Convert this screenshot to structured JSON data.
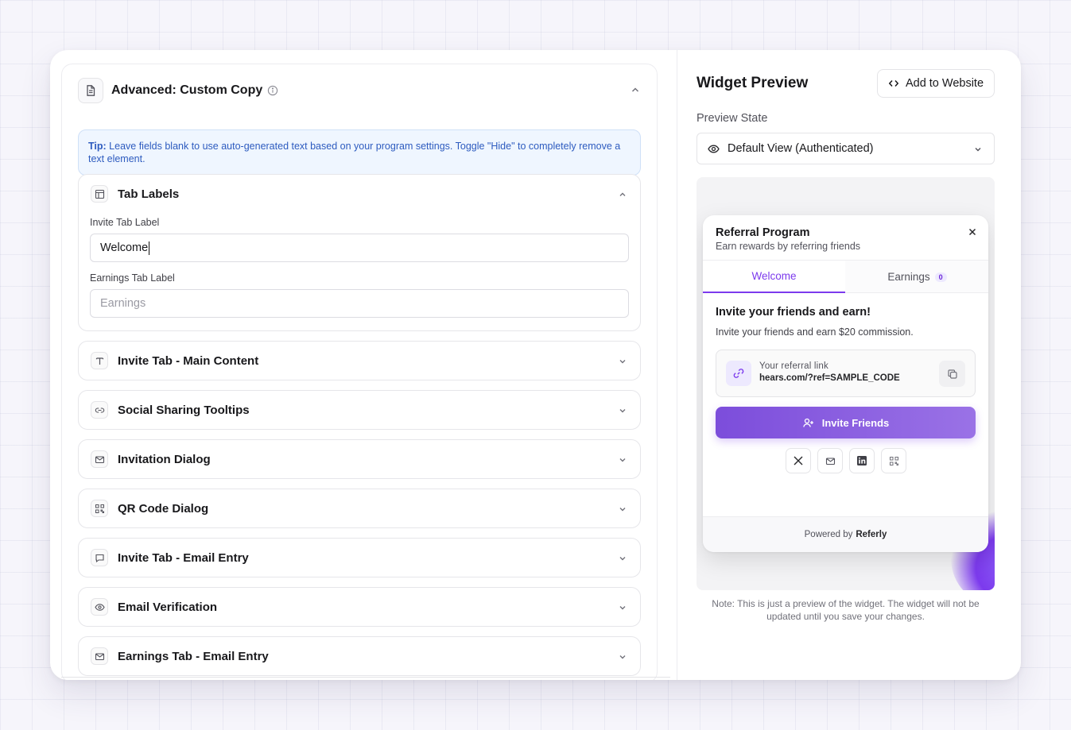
{
  "panel": {
    "title": "Advanced: Custom Copy",
    "tip_prefix": "Tip:",
    "tip_text": " Leave fields blank to use auto-generated text based on your program settings. Toggle \"Hide\" to completely remove a text element."
  },
  "tab_labels": {
    "title": "Tab Labels",
    "invite_label": "Invite Tab Label",
    "invite_value": "Welcome",
    "earnings_label": "Earnings Tab Label",
    "earnings_placeholder": "Earnings"
  },
  "sections": [
    {
      "title": "Invite Tab - Main Content",
      "icon": "text-icon"
    },
    {
      "title": "Social Sharing Tooltips",
      "icon": "link-icon"
    },
    {
      "title": "Invitation Dialog",
      "icon": "mail-icon"
    },
    {
      "title": "QR Code Dialog",
      "icon": "qr-code-icon"
    },
    {
      "title": "Invite Tab - Email Entry",
      "icon": "message-icon"
    },
    {
      "title": "Email Verification",
      "icon": "eye-icon"
    },
    {
      "title": "Earnings Tab - Email Entry",
      "icon": "mail-icon"
    }
  ],
  "preview": {
    "title": "Widget Preview",
    "add_button": "Add to Website",
    "state_label": "Preview State",
    "state_value": "Default View (Authenticated)",
    "note": "Note: This is just a preview of the widget. The widget will not be updated until you save your changes."
  },
  "widget": {
    "title": "Referral Program",
    "subtitle": "Earn rewards by referring friends",
    "tab_welcome": "Welcome",
    "tab_earnings": "Earnings",
    "earnings_count": "0",
    "heading": "Invite your friends and earn!",
    "description": "Invite your friends and earn $20 commission.",
    "link_label": "Your referral link",
    "link_url": "hears.com/?ref=SAMPLE_CODE",
    "invite_button": "Invite Friends",
    "powered_by": "Powered by",
    "brand": "Referly"
  },
  "colors": {
    "accent": "#7c3aed",
    "tip_bg": "#eff6ff",
    "tip_text": "#2d5bbf"
  }
}
